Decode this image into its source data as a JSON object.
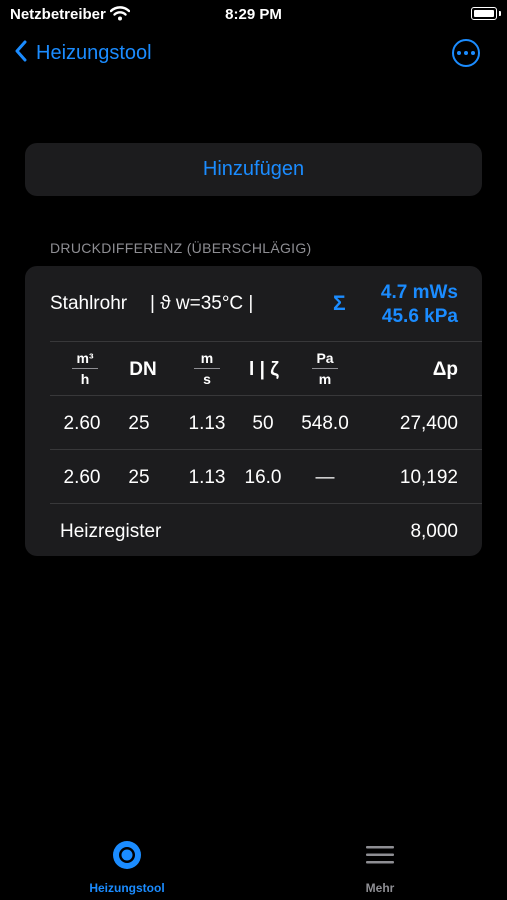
{
  "status": {
    "carrier": "Netzbetreiber",
    "time": "8:29 PM"
  },
  "nav": {
    "back_label": "Heizungstool",
    "more_icon": "ellipsis-circle-icon"
  },
  "add_button": {
    "label": "Hinzufügen"
  },
  "section": {
    "header": "DRUCKDIFFERENZ (ÜBERSCHLÄGIG)"
  },
  "pipe": {
    "type": "Stahlrohr",
    "temp": "| ϑ w=35°C |",
    "sigma": "Σ",
    "total_mws": "4.7 mWs",
    "total_kpa": "45.6 kPa"
  },
  "table": {
    "headers": {
      "flow_num": "m³",
      "flow_den": "h",
      "dn": "DN",
      "vel_num": "m",
      "vel_den": "s",
      "len": "l | ζ",
      "r_num": "Pa",
      "r_den": "m",
      "dp": "Δp"
    },
    "rows": [
      {
        "flow": "2.60",
        "dn": "25",
        "vel": "1.13",
        "len": "50",
        "r": "548.0",
        "dp": "27,400"
      },
      {
        "flow": "2.60",
        "dn": "25",
        "vel": "1.13",
        "len": "16.0",
        "r": "—",
        "dp": "10,192"
      }
    ],
    "extra": {
      "label": "Heizregister",
      "value": "8,000"
    }
  },
  "tabs": [
    {
      "label": "Heizungstool",
      "icon": "target-circle-icon",
      "active": true
    },
    {
      "label": "Mehr",
      "icon": "hamburger-menu-icon",
      "active": false
    }
  ],
  "colors": {
    "accent": "#1b8cff",
    "card": "#1c1c1e",
    "background": "#000000",
    "secondary": "#8e8e93"
  }
}
